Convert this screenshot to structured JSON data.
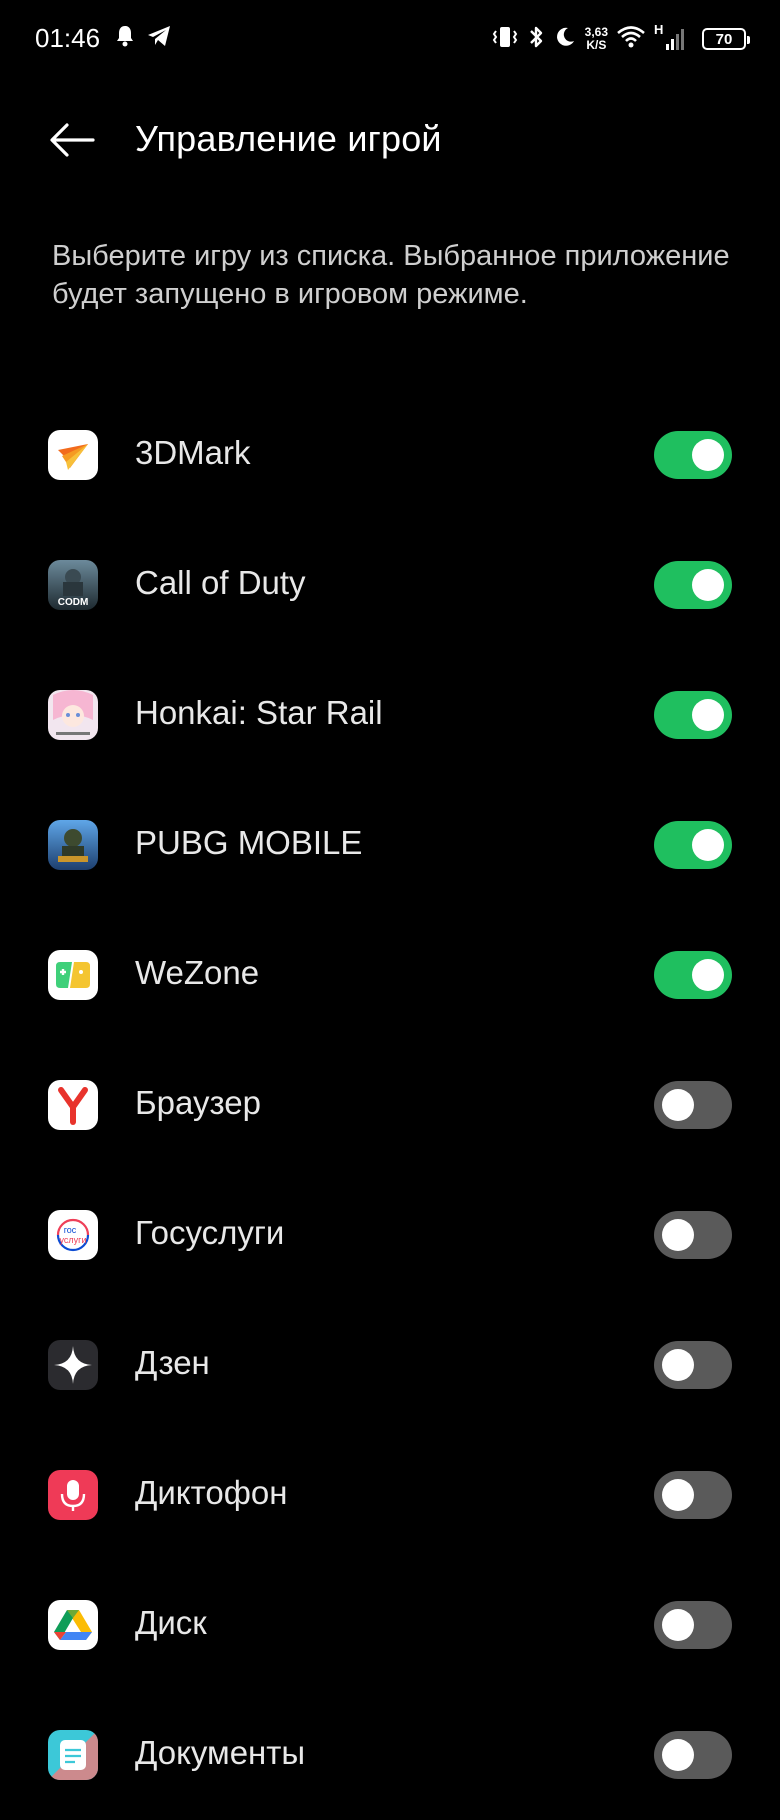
{
  "status_bar": {
    "time": "01:46",
    "net_speed_value": "3,63",
    "net_speed_unit": "K/S",
    "network_type": "H",
    "battery_level": "70"
  },
  "header": {
    "title": "Управление игрой"
  },
  "description": "Выберите игру из списка. Выбранное приложение будет запущено в игровом режиме.",
  "apps": [
    {
      "name": "3DMark",
      "enabled": true,
      "icon": "3dmark-icon"
    },
    {
      "name": "Call of Duty",
      "enabled": true,
      "icon": "call-of-duty-icon"
    },
    {
      "name": "Honkai: Star Rail",
      "enabled": true,
      "icon": "honkai-star-rail-icon"
    },
    {
      "name": "PUBG MOBILE",
      "enabled": true,
      "icon": "pubg-mobile-icon"
    },
    {
      "name": "WeZone",
      "enabled": true,
      "icon": "wezone-icon"
    },
    {
      "name": "Браузер",
      "enabled": false,
      "icon": "yandex-browser-icon"
    },
    {
      "name": "Госуслуги",
      "enabled": false,
      "icon": "gosuslugi-icon"
    },
    {
      "name": "Дзен",
      "enabled": false,
      "icon": "dzen-icon"
    },
    {
      "name": "Диктофон",
      "enabled": false,
      "icon": "dictaphone-icon"
    },
    {
      "name": "Диск",
      "enabled": false,
      "icon": "google-drive-icon"
    },
    {
      "name": "Документы",
      "enabled": false,
      "icon": "documents-icon"
    }
  ],
  "icon_texts": {
    "codm": "CODM",
    "gosuslugi_top": "гос",
    "gosuslugi_bottom": "услуги"
  },
  "colors": {
    "background": "#000000",
    "toggle_on": "#1fbf5f",
    "toggle_off": "#5a5a5a",
    "knob": "#ffffff"
  }
}
